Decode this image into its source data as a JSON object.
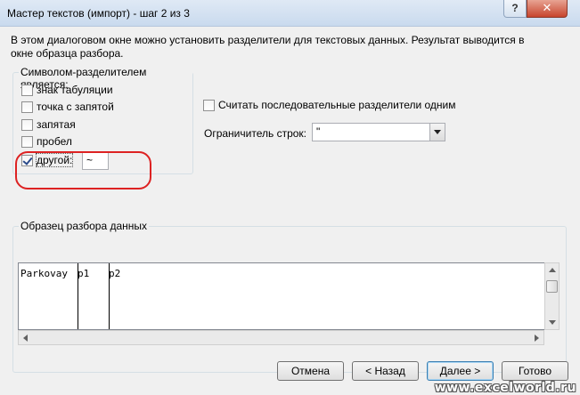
{
  "window": {
    "title": "Мастер текстов (импорт) - шаг 2 из 3",
    "help_glyph": "?",
    "close_glyph": "✕"
  },
  "description": "В этом диалоговом окне можно установить разделители для текстовых данных. Результат выводится в окне образца разбора.",
  "delimiters": {
    "title": "Символом-разделителем является:",
    "tab": {
      "label": "знак табуляции",
      "checked": false
    },
    "semicolon": {
      "label": "точка с запятой",
      "checked": false
    },
    "comma": {
      "label": "запятая",
      "checked": false
    },
    "space": {
      "label": "пробел",
      "checked": false
    },
    "other": {
      "label": "другой:",
      "checked": true,
      "value": "~"
    }
  },
  "consecutive": {
    "label": "Считать последовательные разделители одним",
    "checked": false
  },
  "text_qualifier": {
    "label": "Ограничитель строк:",
    "value": "\""
  },
  "preview": {
    "title": "Образец разбора данных",
    "columns": [
      "Parkovay",
      "p1",
      "p2"
    ]
  },
  "buttons": {
    "cancel": "Отмена",
    "back": "< Назад",
    "next": "Далее >",
    "finish": "Готово"
  },
  "watermark": "www.excelworld.ru",
  "colors": {
    "annotation_oval": "#dd2222",
    "close_button": "#c7452d"
  }
}
